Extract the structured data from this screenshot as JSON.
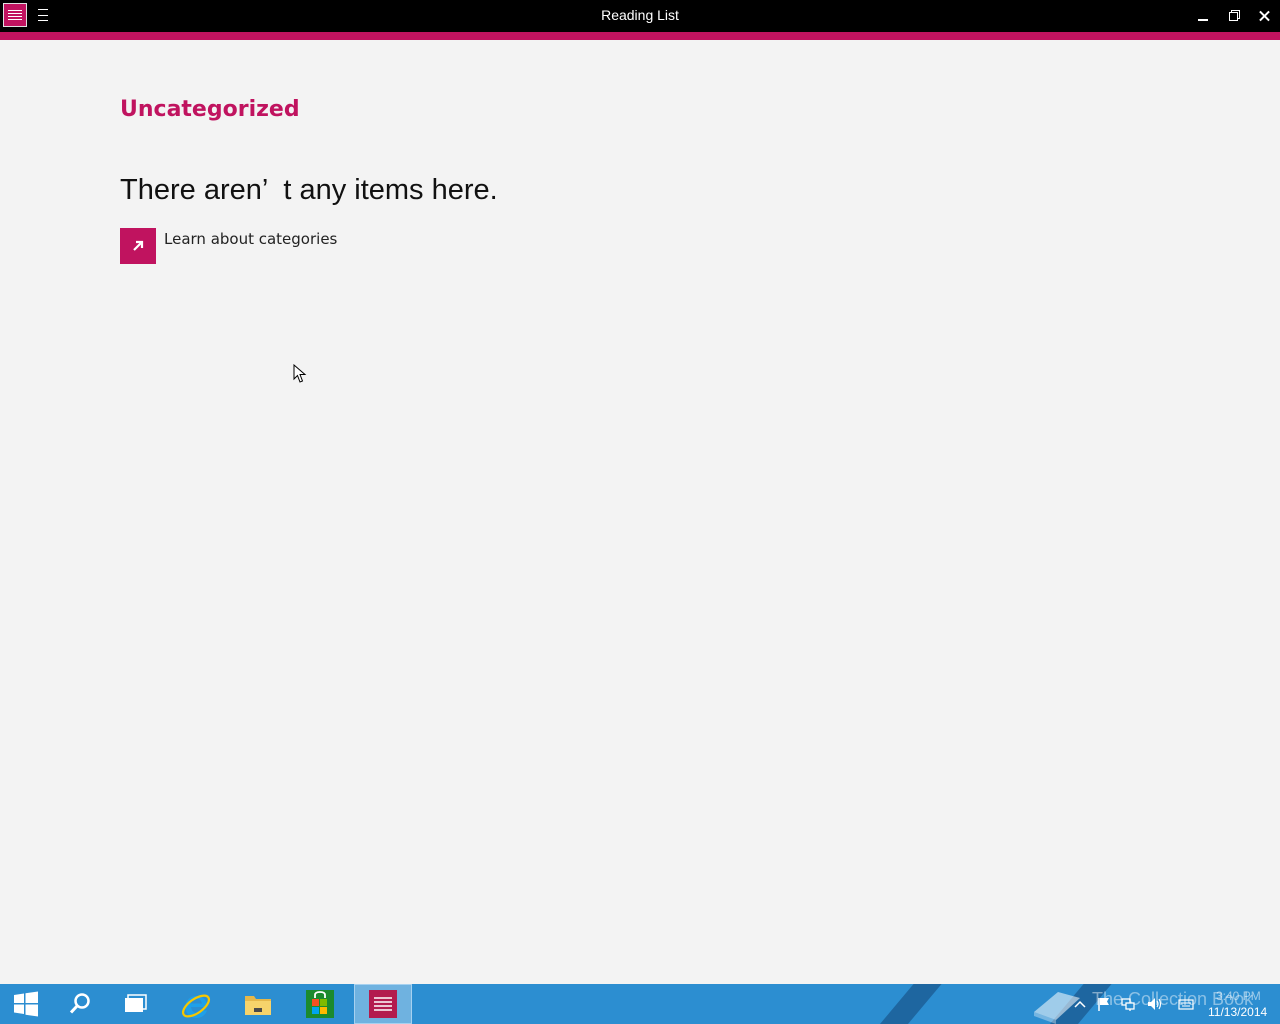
{
  "window": {
    "title": "Reading List",
    "app_icon": "reading-list-icon",
    "menu_icon": "hamburger-icon",
    "controls": [
      "minimize-icon",
      "restore-icon",
      "close-icon"
    ]
  },
  "content": {
    "category_title": "Uncategorized",
    "empty_message": "There aren’  t any items here.",
    "learn_link_label": "Learn about categories",
    "learn_link_icon": "arrow-up-right-icon"
  },
  "taskbar": {
    "items": [
      "windows-start-icon",
      "search-icon",
      "task-view-icon",
      "internet-explorer-icon",
      "file-explorer-icon",
      "store-icon",
      "reading-list-icon"
    ],
    "tray_icons": [
      "chevron-up-icon",
      "flag-icon",
      "network-icon",
      "volume-icon",
      "keyboard-icon"
    ],
    "watermark": "The Collection Book",
    "time": "3:40 PM",
    "date": "11/13/2014"
  },
  "colors": {
    "accent": "#c0135f",
    "title_bar": "#000000",
    "background": "#f3f3f3",
    "taskbar": "#2c8ed1"
  }
}
